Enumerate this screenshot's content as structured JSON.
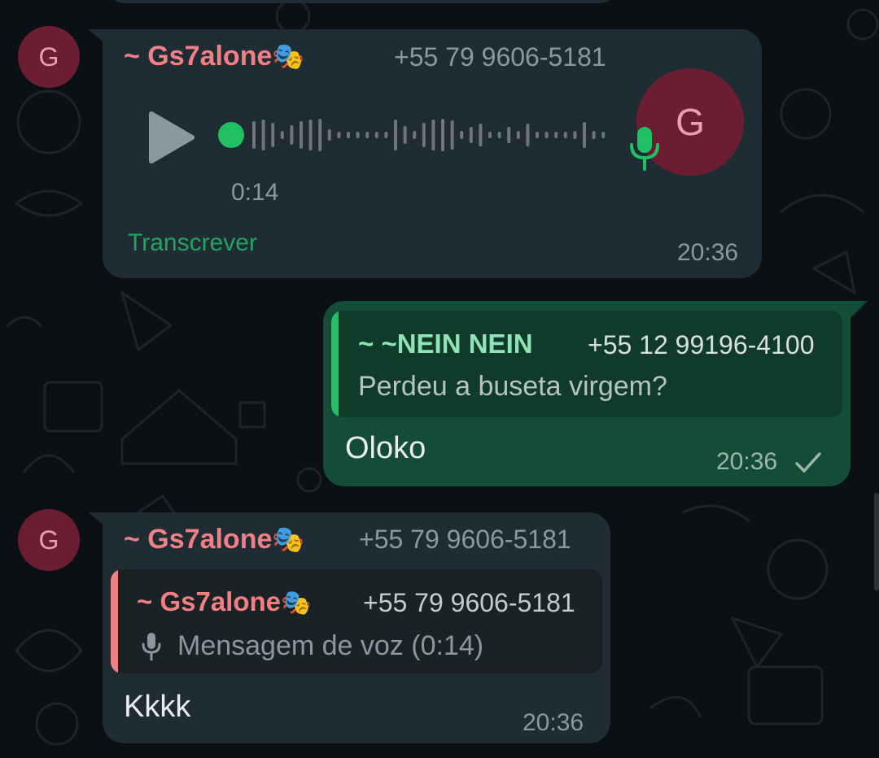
{
  "chat": {
    "msg1": {
      "avatar_initial": "G",
      "sender": "~ Gs7alone",
      "sender_emoji": "🎭",
      "phone": "+55 79 9606-5181",
      "voice": {
        "duration": "0:14",
        "progress": 0,
        "avatar_initial": "G"
      },
      "transcribe_label": "Transcrever",
      "time": "20:36"
    },
    "msg2": {
      "quote": {
        "sender": "~ ~NEIN NEIN",
        "phone": "+55 12 99196-4100",
        "text": "Perdeu a buseta virgem?"
      },
      "text": "Oloko",
      "time": "20:36",
      "status": "sent"
    },
    "msg3": {
      "avatar_initial": "G",
      "sender": "~ Gs7alone",
      "sender_emoji": "🎭",
      "phone": "+55 79 9606-5181",
      "quote": {
        "sender": "~ Gs7alone",
        "sender_emoji": "🎭",
        "phone": "+55 79 9606-5181",
        "text": "Mensagem de voz (0:14)"
      },
      "text": "Kkkk",
      "time": "20:36"
    }
  },
  "colors": {
    "background": "#0b1014",
    "incoming_bubble": "#202c33",
    "outgoing_bubble": "#144d37",
    "sender_name": "#f07f86",
    "quote_sender_out": "#8fe3b4",
    "accent_green": "#21c063",
    "avatar_bg": "#6b1d32",
    "avatar_text": "#ea9fae"
  }
}
